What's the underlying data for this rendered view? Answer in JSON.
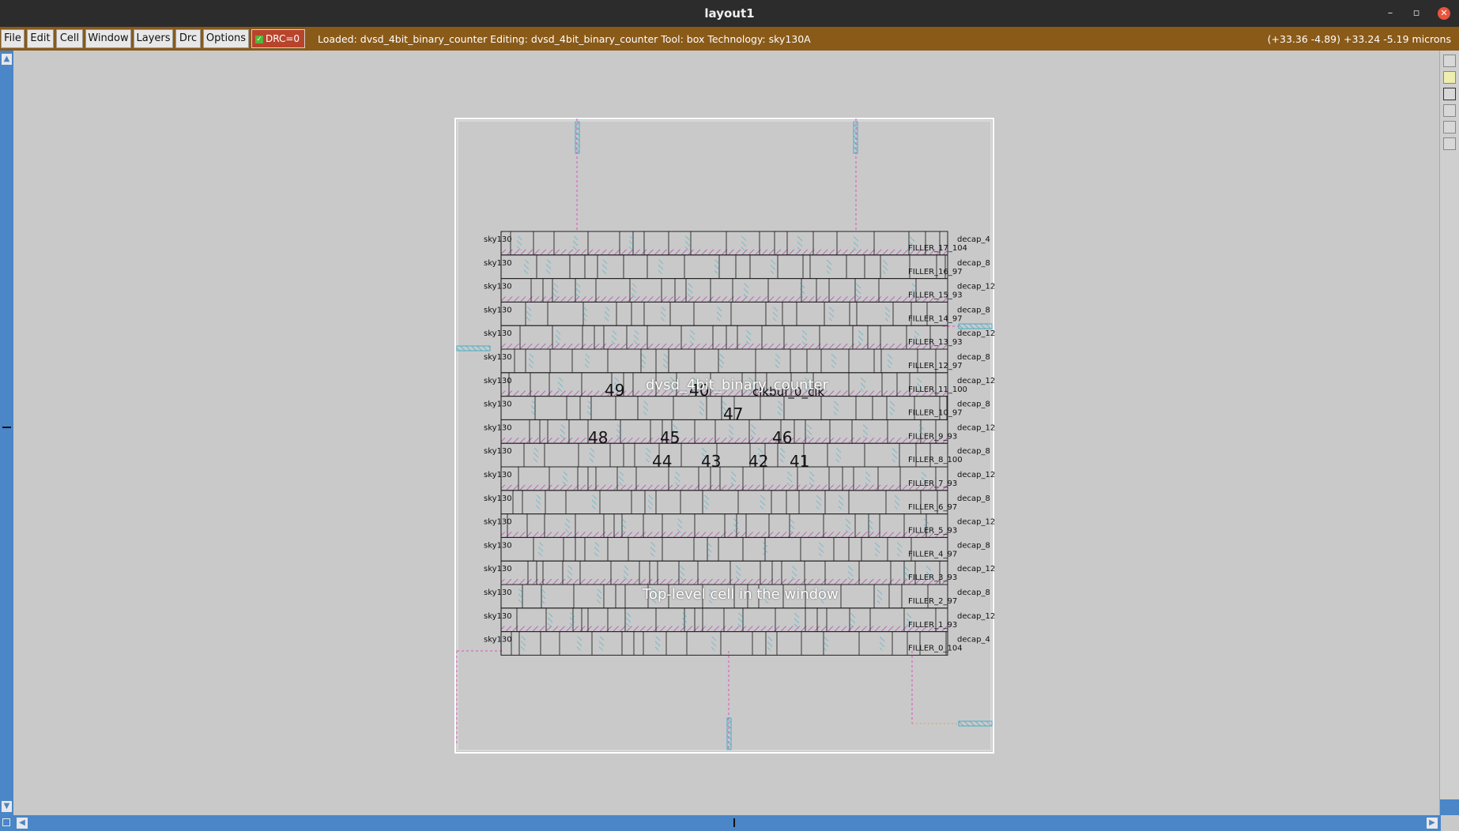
{
  "window": {
    "title": "layout1",
    "minimize": "–",
    "restore": "▫",
    "close": "✕"
  },
  "menu": {
    "items": [
      "File",
      "Edit",
      "Cell",
      "Window",
      "Layers",
      "Drc",
      "Options"
    ],
    "drc_label": "DRC=0",
    "status": "Loaded: dvsd_4bit_binary_counter Editing: dvsd_4bit_binary_counter Tool: box  Technology: sky130A",
    "coords": "(+33.36 -4.89) +33.24 -5.19 microns"
  },
  "layout": {
    "cell_name": "dvsd_4bit_binary_counter",
    "placeholder": "Top-level cell in the window",
    "clk_label": "clkbuf_0_clk",
    "row_prefix": "sky130",
    "net_numbers": [
      "49",
      "48",
      "47",
      "46",
      "45",
      "44",
      "43",
      "42",
      "41",
      "40"
    ],
    "decap_labels": [
      "decap_4",
      "decap_8",
      "decap_12"
    ],
    "fillers": [
      "FILLER_17_104",
      "FILLER_16_97",
      "FILLER_15_93",
      "FILLER_14_97",
      "FILLER_13_93",
      "FILLER_12_97",
      "FILLER_11_100",
      "FILLER_10_97",
      "FILLER_9_93",
      "FILLER_8_100",
      "FILLER_7_93",
      "FILLER_6_97",
      "FILLER_5_93",
      "FILLER_4_97",
      "FILLER_3_93",
      "FILLER_2_97",
      "FILLER_1_93",
      "FILLER_0_104"
    ]
  },
  "colors": {
    "menubar": "#8a5a18",
    "scrollbar": "#4a86c8",
    "canvas": "#c9c9c9",
    "drc": "#b8442c"
  }
}
